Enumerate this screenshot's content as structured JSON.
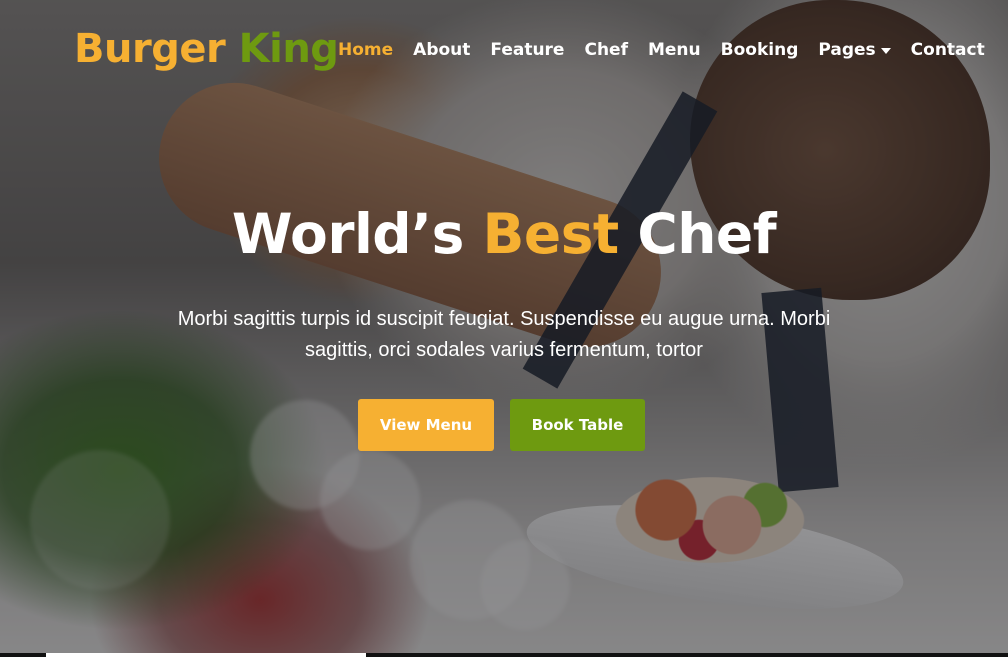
{
  "brand": {
    "part1": "Burger",
    "part2": "King"
  },
  "nav": {
    "items": [
      {
        "label": "Home",
        "active": true
      },
      {
        "label": "About"
      },
      {
        "label": "Feature"
      },
      {
        "label": "Chef"
      },
      {
        "label": "Menu"
      },
      {
        "label": "Booking"
      },
      {
        "label": "Pages",
        "dropdown": true
      },
      {
        "label": "Contact"
      }
    ]
  },
  "hero": {
    "title_part1": "World’s",
    "title_accent": "Best",
    "title_part2": "Chef",
    "subtitle": "Morbi sagittis turpis id suscipit feugiat. Suspendisse eu augue urna. Morbi sagittis, orci sodales varius fermentum, tortor",
    "primary_button": "View Menu",
    "secondary_button": "Book Table"
  },
  "colors": {
    "accent_orange": "#f6b032",
    "accent_green": "#6e9a10",
    "text_white": "#ffffff"
  }
}
